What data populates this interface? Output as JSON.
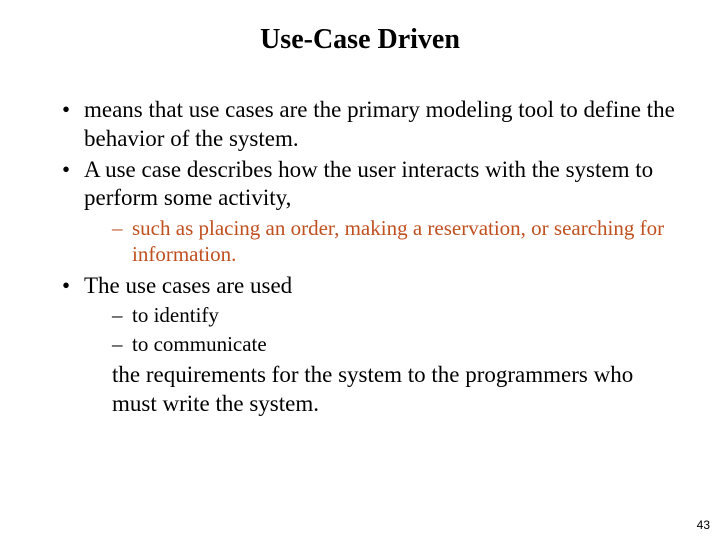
{
  "title": "Use-Case Driven",
  "bullets": {
    "b1": "means that use cases are the primary modeling tool to define the behavior of the system.",
    "b2": "A use case describes how the user interacts with the system to perform some activity,",
    "b2_sub": "such as placing an order, making a reservation, or searching for information.",
    "b3": "The use cases are used",
    "b3_sub1": "to identify",
    "b3_sub2": "to communicate",
    "b3_trailing": "the requirements for the system to the programmers who must write the system."
  },
  "page_number": "43"
}
